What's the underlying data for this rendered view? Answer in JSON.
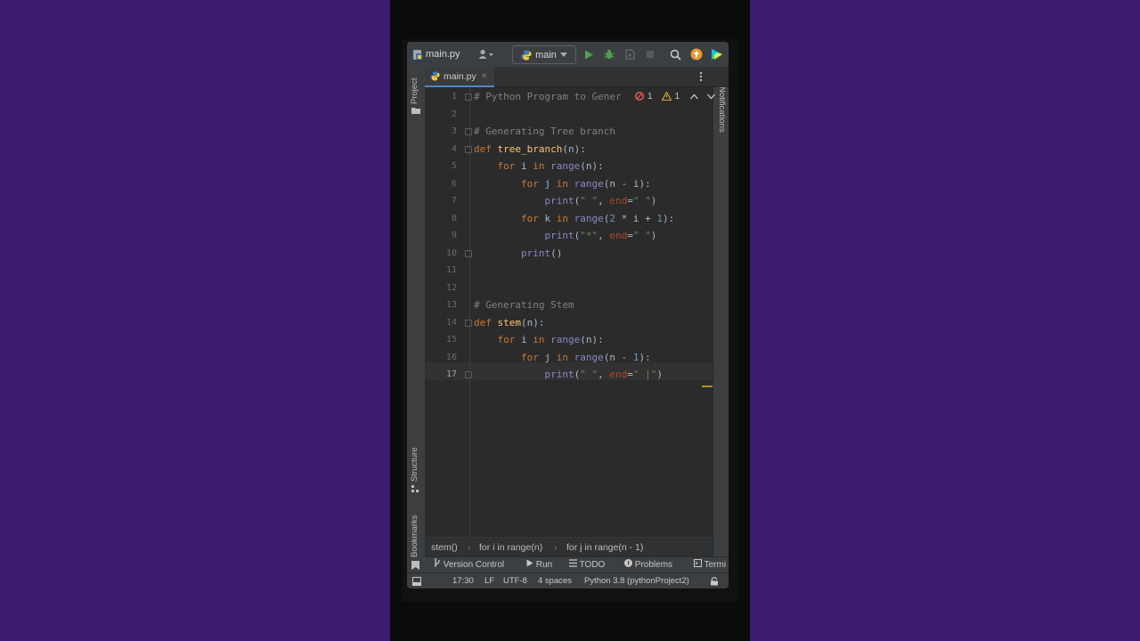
{
  "toolbar": {
    "file_title": "main.py",
    "run_config": "main"
  },
  "tabs": [
    {
      "label": "main.py",
      "close": "×"
    }
  ],
  "side_tools": {
    "project": "Project",
    "structure": "Structure",
    "bookmarks": "Bookmarks",
    "notifications": "Notifications"
  },
  "inspections": {
    "errors": "1",
    "warnings": "1"
  },
  "editor": {
    "current_line": 17,
    "lines": [
      {
        "n": "1",
        "tokens": [
          {
            "t": "# Python Program to Gener",
            "c": "cm"
          }
        ]
      },
      {
        "n": "2",
        "tokens": []
      },
      {
        "n": "3",
        "tokens": [
          {
            "t": "# Generating Tree branch",
            "c": "cm"
          }
        ]
      },
      {
        "n": "4",
        "tokens": [
          {
            "t": "def ",
            "c": "kw"
          },
          {
            "t": "tree_branch",
            "c": "fn"
          },
          {
            "t": "(n):",
            "c": "tx"
          }
        ]
      },
      {
        "n": "5",
        "tokens": [
          {
            "t": "    for ",
            "c": "kw"
          },
          {
            "t": "i ",
            "c": "tx"
          },
          {
            "t": "in ",
            "c": "kw"
          },
          {
            "t": "range",
            "c": "bi"
          },
          {
            "t": "(n):",
            "c": "tx"
          }
        ]
      },
      {
        "n": "6",
        "tokens": [
          {
            "t": "        for ",
            "c": "kw"
          },
          {
            "t": "j ",
            "c": "tx"
          },
          {
            "t": "in ",
            "c": "kw"
          },
          {
            "t": "range",
            "c": "bi"
          },
          {
            "t": "(n - i):",
            "c": "tx"
          }
        ]
      },
      {
        "n": "7",
        "tokens": [
          {
            "t": "            print",
            "c": "bi"
          },
          {
            "t": "(",
            "c": "tx"
          },
          {
            "t": "\" \"",
            "c": "str"
          },
          {
            "t": ", ",
            "c": "tx"
          },
          {
            "t": "end",
            "c": "par"
          },
          {
            "t": "=",
            "c": "tx"
          },
          {
            "t": "\" \"",
            "c": "str"
          },
          {
            "t": ")",
            "c": "tx"
          }
        ]
      },
      {
        "n": "8",
        "tokens": [
          {
            "t": "        for ",
            "c": "kw"
          },
          {
            "t": "k ",
            "c": "tx"
          },
          {
            "t": "in ",
            "c": "kw"
          },
          {
            "t": "range",
            "c": "bi"
          },
          {
            "t": "(",
            "c": "tx"
          },
          {
            "t": "2",
            "c": "nb"
          },
          {
            "t": " * i + ",
            "c": "tx"
          },
          {
            "t": "1",
            "c": "nb"
          },
          {
            "t": "):",
            "c": "tx"
          }
        ]
      },
      {
        "n": "9",
        "tokens": [
          {
            "t": "            print",
            "c": "bi"
          },
          {
            "t": "(",
            "c": "tx"
          },
          {
            "t": "\"*\"",
            "c": "str"
          },
          {
            "t": ", ",
            "c": "tx"
          },
          {
            "t": "end",
            "c": "par"
          },
          {
            "t": "=",
            "c": "tx"
          },
          {
            "t": "\" \"",
            "c": "str"
          },
          {
            "t": ")",
            "c": "tx"
          }
        ]
      },
      {
        "n": "10",
        "tokens": [
          {
            "t": "        print",
            "c": "bi"
          },
          {
            "t": "()",
            "c": "tx"
          }
        ]
      },
      {
        "n": "11",
        "tokens": []
      },
      {
        "n": "12",
        "tokens": []
      },
      {
        "n": "13",
        "tokens": [
          {
            "t": "# Generating Stem",
            "c": "cm"
          }
        ]
      },
      {
        "n": "14",
        "tokens": [
          {
            "t": "def ",
            "c": "kw"
          },
          {
            "t": "stem",
            "c": "fn"
          },
          {
            "t": "(n):",
            "c": "tx"
          }
        ]
      },
      {
        "n": "15",
        "tokens": [
          {
            "t": "    for ",
            "c": "kw"
          },
          {
            "t": "i ",
            "c": "tx"
          },
          {
            "t": "in ",
            "c": "kw"
          },
          {
            "t": "range",
            "c": "bi"
          },
          {
            "t": "(n):",
            "c": "tx"
          }
        ]
      },
      {
        "n": "16",
        "tokens": [
          {
            "t": "        for ",
            "c": "kw"
          },
          {
            "t": "j ",
            "c": "tx"
          },
          {
            "t": "in ",
            "c": "kw"
          },
          {
            "t": "range",
            "c": "bi"
          },
          {
            "t": "(n - ",
            "c": "tx"
          },
          {
            "t": "1",
            "c": "nb"
          },
          {
            "t": "):",
            "c": "tx"
          }
        ]
      },
      {
        "n": "17",
        "tokens": [
          {
            "t": "            print",
            "c": "bi"
          },
          {
            "t": "(",
            "c": "tx"
          },
          {
            "t": "\" \"",
            "c": "str"
          },
          {
            "t": ", ",
            "c": "tx"
          },
          {
            "t": "end",
            "c": "par"
          },
          {
            "t": "=",
            "c": "tx"
          },
          {
            "t": "\" |\"",
            "c": "str"
          },
          {
            "t": ")",
            "c": "tx"
          }
        ]
      }
    ]
  },
  "breadcrumb": [
    "stem()",
    "for i in range(n)",
    "for j in range(n - 1)"
  ],
  "tool_windows": [
    "Version Control",
    "Run",
    "TODO",
    "Problems",
    "Termi"
  ],
  "status_bar": {
    "position": "17:30",
    "line_sep": "LF",
    "encoding": "UTF-8",
    "indent": "4 spaces",
    "interpreter": "Python 3.8 (pythonProject2)"
  },
  "colors": {
    "background": "#3d1e6e",
    "keyword": "#cc7832",
    "function": "#ffc66d",
    "string": "#6a8759",
    "comment": "#808080",
    "number": "#6897bb",
    "builtin": "#8888c6",
    "param": "#aa4926",
    "accent": "#4a88c7"
  }
}
